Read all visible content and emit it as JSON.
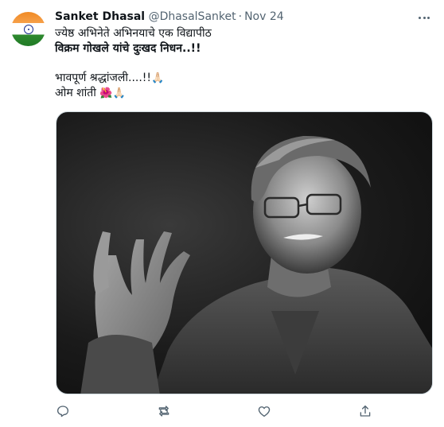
{
  "tweet": {
    "author_name": "Sanket Dhasal",
    "handle": "@DhasalSanket",
    "separator": "·",
    "date": "Nov 24",
    "lines": {
      "line1": "ज्येष्ठ अभिनेते अभिनयाचे एक विद्यापीठ",
      "line2": "विक्रम गोखले यांचे दुःखद निधन..!!",
      "line3": "भावपूर्ण श्रद्धांजली....!!",
      "line3_emoji": "🙏🏻",
      "line4": "ओम शांती",
      "line4_emoji": "🌺🙏🏻"
    }
  },
  "icons": {
    "more": "more-dots-icon",
    "reply": "reply-icon",
    "retweet": "retweet-icon",
    "like": "like-icon",
    "share": "share-icon"
  },
  "colors": {
    "text": "#0f1419",
    "secondary": "#536471",
    "photo_bg": "#1a1a1a"
  }
}
